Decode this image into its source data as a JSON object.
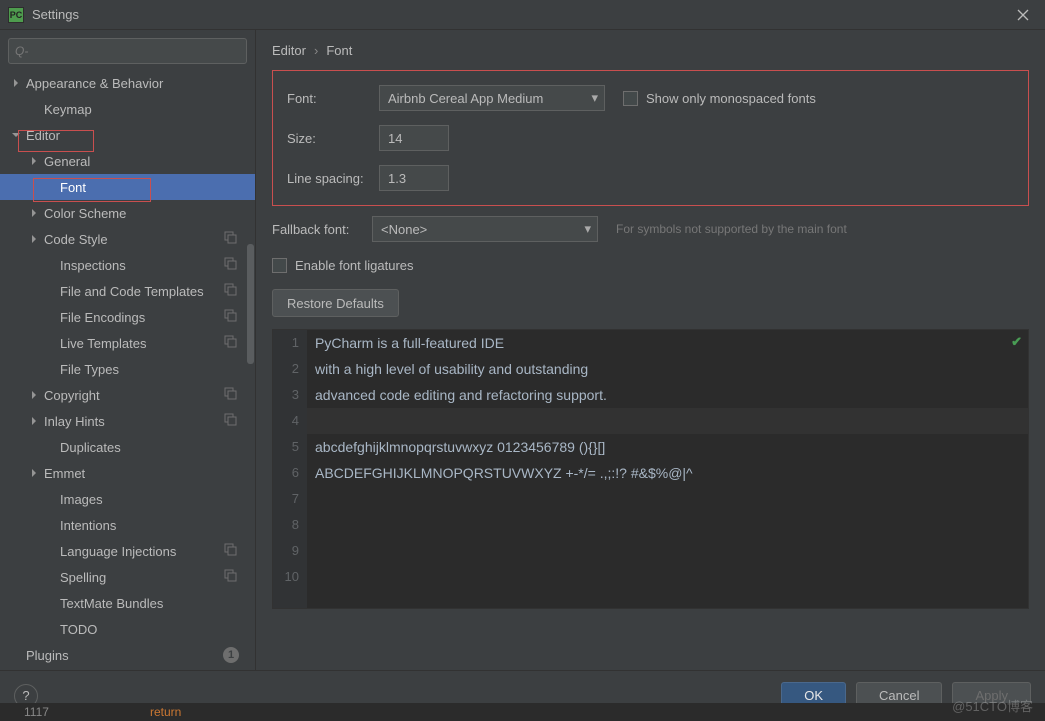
{
  "title": "Settings",
  "search_placeholder": "Q-",
  "breadcrumb": {
    "a": "Editor",
    "b": "Font"
  },
  "sidebar": {
    "items": [
      {
        "label": "Appearance & Behavior",
        "arrow": "right",
        "indent": 0
      },
      {
        "label": "Keymap",
        "indent": 1
      },
      {
        "label": "Editor",
        "arrow": "down",
        "indent": 0
      },
      {
        "label": "General",
        "arrow": "right",
        "indent": 1
      },
      {
        "label": "Font",
        "indent": 2,
        "selected": true
      },
      {
        "label": "Color Scheme",
        "arrow": "right",
        "indent": 1
      },
      {
        "label": "Code Style",
        "arrow": "right",
        "indent": 1,
        "copy": true
      },
      {
        "label": "Inspections",
        "indent": 2,
        "copy": true
      },
      {
        "label": "File and Code Templates",
        "indent": 2,
        "copy": true
      },
      {
        "label": "File Encodings",
        "indent": 2,
        "copy": true
      },
      {
        "label": "Live Templates",
        "indent": 2,
        "copy": true
      },
      {
        "label": "File Types",
        "indent": 2
      },
      {
        "label": "Copyright",
        "arrow": "right",
        "indent": 1,
        "copy": true
      },
      {
        "label": "Inlay Hints",
        "arrow": "right",
        "indent": 1,
        "copy": true
      },
      {
        "label": "Duplicates",
        "indent": 2
      },
      {
        "label": "Emmet",
        "arrow": "right",
        "indent": 1
      },
      {
        "label": "Images",
        "indent": 2
      },
      {
        "label": "Intentions",
        "indent": 2
      },
      {
        "label": "Language Injections",
        "indent": 2,
        "copy": true
      },
      {
        "label": "Spelling",
        "indent": 2,
        "copy": true
      },
      {
        "label": "TextMate Bundles",
        "indent": 2
      },
      {
        "label": "TODO",
        "indent": 2
      },
      {
        "label": "Plugins",
        "indent": 0,
        "badge": "1"
      }
    ]
  },
  "form": {
    "font_label": "Font:",
    "font_value": "Airbnb Cereal App Medium",
    "size_label": "Size:",
    "size_value": "14",
    "linespacing_label": "Line spacing:",
    "linespacing_value": "1.3",
    "mono_label": "Show only monospaced fonts",
    "fallback_label": "Fallback font:",
    "fallback_value": "<None>",
    "fallback_info": "For symbols not supported by the main font",
    "ligatures_label": "Enable font ligatures",
    "restore_label": "Restore Defaults"
  },
  "preview_lines": [
    "PyCharm is a full-featured IDE",
    "with a high level of usability and outstanding",
    "advanced code editing and refactoring support.",
    "",
    "abcdefghijklmnopqrstuvwxyz 0123456789 (){}[]",
    "ABCDEFGHIJKLMNOPQRSTUVWXYZ +-*/= .,;:!? #&$%@|^",
    "",
    "",
    "",
    ""
  ],
  "footer": {
    "ok": "OK",
    "cancel": "Cancel",
    "apply": "Apply"
  },
  "watermark": "@51CTO博客",
  "editor_hint": {
    "ln": "1117",
    "kw": "return"
  }
}
